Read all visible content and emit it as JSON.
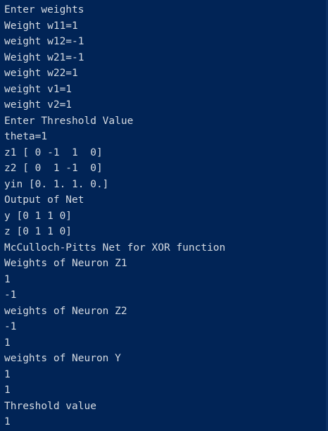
{
  "window": {
    "background": "#012456",
    "text_color": "#d6dbe2"
  },
  "console": {
    "lines": [
      "Enter weights",
      "Weight w11=1",
      "weight w12=-1",
      "Weight w21=-1",
      "weight w22=1",
      "weight v1=1",
      "weight v2=1",
      "Enter Threshold Value",
      "theta=1",
      "z1 [ 0 -1  1  0]",
      "z2 [ 0  1 -1  0]",
      "yin [0. 1. 1. 0.]",
      "Output of Net",
      "y [0 1 1 0]",
      "z [0 1 1 0]",
      "McCulloch-Pitts Net for XOR function",
      "Weights of Neuron Z1",
      "1",
      "-1",
      "weights of Neuron Z2",
      "-1",
      "1",
      "weights of Neuron Y",
      "1",
      "1",
      "Threshold value",
      "1"
    ]
  }
}
